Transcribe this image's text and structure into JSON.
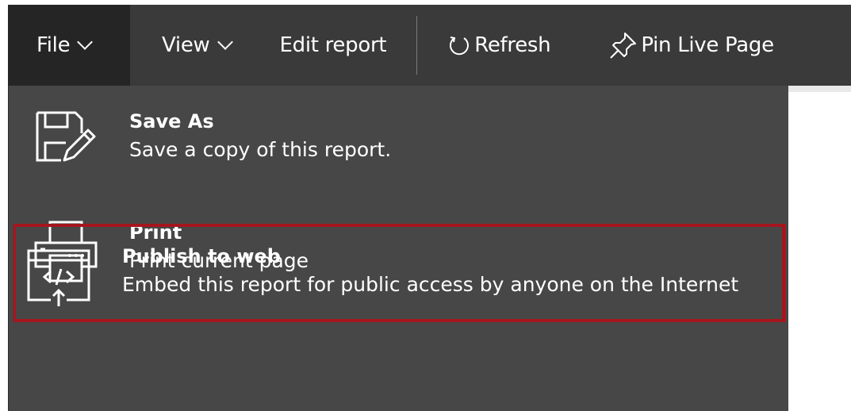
{
  "toolbar": {
    "file_label": "File",
    "view_label": "View",
    "edit_label": "Edit report",
    "refresh_label": "Refresh",
    "pin_label": "Pin Live Page"
  },
  "file_menu": {
    "items": [
      {
        "icon": "save-as-icon",
        "title": "Save As",
        "description": "Save a copy of this report."
      },
      {
        "icon": "print-icon",
        "title": "Print",
        "description": "Print current page"
      },
      {
        "icon": "publish-to-web-icon",
        "title": "Publish to web",
        "description": "Embed this report for public access by anyone on the Internet"
      }
    ]
  },
  "colors": {
    "toolbar_bg": "#3a3a3a",
    "active_tab_bg": "#252525",
    "menu_bg": "#474747",
    "highlight_border": "#a4161d",
    "text": "#ffffff"
  }
}
